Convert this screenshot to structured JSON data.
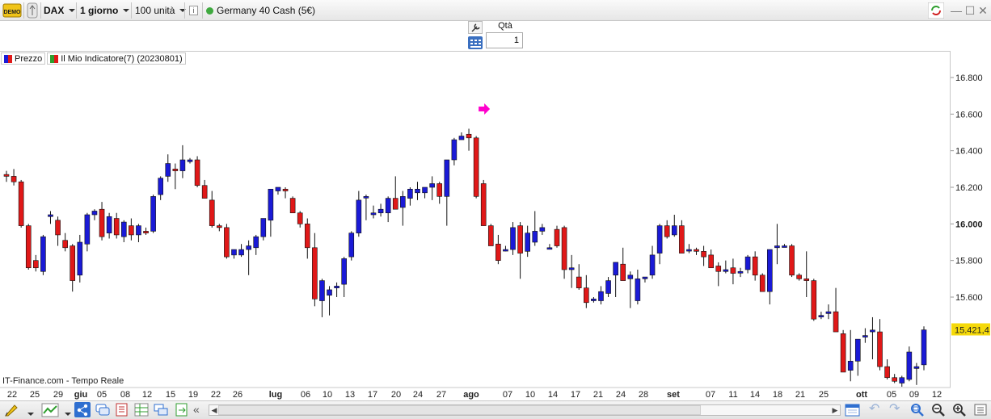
{
  "toolbar": {
    "demo_label": "DEMO",
    "instrument": "DAX",
    "timeframe": "1 giorno",
    "units": "100 unità",
    "info_label": "i",
    "market": "Germany 40 Cash (5€)",
    "market_status_color": "#3fa93f"
  },
  "order": {
    "qty_label": "Qtà",
    "qty_value": "1"
  },
  "legend": {
    "price_label": "Prezzo",
    "indicator_label": "Il Mio Indicatore(7) (20230801)"
  },
  "watermark": "IT-Finance.com - Tempo Reale",
  "colors": {
    "up": "#1a1ad6",
    "down": "#e01818",
    "arrow": "#ff00cc",
    "price_tag": "#f5d90a"
  },
  "chart_data": {
    "type": "candlestick",
    "y_axis": {
      "labels": [
        "16.800",
        "16.600",
        "16.400",
        "16.200",
        "16.000",
        "15.800",
        "15.600"
      ],
      "min": 15300,
      "max": 16900
    },
    "last_price": "15.421,4",
    "x_axis_labels": [
      "22",
      "25",
      "29",
      "giu",
      "05",
      "08",
      "12",
      "15",
      "19",
      "22",
      "26",
      "lug",
      "06",
      "10",
      "13",
      "17",
      "20",
      "24",
      "27",
      "ago",
      "07",
      "10",
      "14",
      "17",
      "21",
      "24",
      "28",
      "set",
      "07",
      "11",
      "14",
      "18",
      "21",
      "25",
      "ott",
      "05",
      "09",
      "12"
    ],
    "bold_x_labels": [
      "giu",
      "lug",
      "ago",
      "set",
      "ott"
    ],
    "signal_arrow": {
      "direction": "right",
      "date_index": 64
    },
    "candles": [
      [
        16270,
        16290,
        16230,
        16260
      ],
      [
        16260,
        16300,
        16210,
        16230
      ],
      [
        16230,
        16240,
        15980,
        15990
      ],
      [
        15990,
        16000,
        15750,
        15760
      ],
      [
        15800,
        15830,
        15740,
        15760
      ],
      [
        15740,
        15940,
        15720,
        15930
      ],
      [
        16040,
        16070,
        16000,
        16050
      ],
      [
        16020,
        16040,
        15880,
        15940
      ],
      [
        15910,
        15950,
        15850,
        15870
      ],
      [
        15880,
        15890,
        15630,
        15690
      ],
      [
        15720,
        15940,
        15680,
        15900
      ],
      [
        15890,
        16060,
        15850,
        16050
      ],
      [
        16050,
        16080,
        16020,
        16070
      ],
      [
        16080,
        16120,
        15910,
        15930
      ],
      [
        15950,
        16060,
        15920,
        16040
      ],
      [
        16030,
        16060,
        15920,
        15940
      ],
      [
        15930,
        16020,
        15900,
        16010
      ],
      [
        15990,
        16030,
        15910,
        15940
      ],
      [
        15940,
        16000,
        15900,
        15990
      ],
      [
        15960,
        15980,
        15940,
        15950
      ],
      [
        15960,
        16160,
        15950,
        16150
      ],
      [
        16160,
        16260,
        16130,
        16250
      ],
      [
        16260,
        16380,
        16230,
        16330
      ],
      [
        16300,
        16330,
        16190,
        16290
      ],
      [
        16290,
        16430,
        16250,
        16350
      ],
      [
        16340,
        16360,
        16330,
        16350
      ],
      [
        16350,
        16370,
        16200,
        16210
      ],
      [
        16210,
        16240,
        16140,
        16140
      ],
      [
        16130,
        16180,
        15980,
        15990
      ],
      [
        15990,
        16000,
        15960,
        15980
      ],
      [
        15980,
        16000,
        15810,
        15820
      ],
      [
        15830,
        15860,
        15810,
        15860
      ],
      [
        15830,
        15890,
        15820,
        15860
      ],
      [
        15860,
        15910,
        15720,
        15880
      ],
      [
        15870,
        15940,
        15830,
        15930
      ],
      [
        15930,
        16030,
        15910,
        16030
      ],
      [
        16020,
        16150,
        15930,
        16190
      ],
      [
        16180,
        16200,
        16160,
        16200
      ],
      [
        16190,
        16200,
        16140,
        16180
      ],
      [
        16140,
        16150,
        16060,
        16060
      ],
      [
        16060,
        16070,
        15980,
        16000
      ],
      [
        16000,
        16030,
        15810,
        15870
      ],
      [
        15870,
        15950,
        15550,
        15590
      ],
      [
        15580,
        15700,
        15490,
        15690
      ],
      [
        15610,
        15660,
        15500,
        15640
      ],
      [
        15650,
        15680,
        15600,
        15660
      ],
      [
        15670,
        15820,
        15600,
        15810
      ],
      [
        15820,
        15960,
        15800,
        15950
      ],
      [
        15950,
        16180,
        15930,
        16130
      ],
      [
        16150,
        16160,
        16020,
        16150
      ],
      [
        16050,
        16100,
        16030,
        16060
      ],
      [
        16060,
        16110,
        16040,
        16080
      ],
      [
        16060,
        16150,
        16010,
        16140
      ],
      [
        16140,
        16260,
        16080,
        16080
      ],
      [
        16090,
        16180,
        15990,
        16150
      ],
      [
        16140,
        16200,
        16100,
        16190
      ],
      [
        16170,
        16230,
        16130,
        16190
      ],
      [
        16170,
        16200,
        16140,
        16200
      ],
      [
        16200,
        16260,
        16130,
        16220
      ],
      [
        16220,
        16230,
        16110,
        16150
      ],
      [
        16150,
        16220,
        15990,
        16350
      ],
      [
        16350,
        16470,
        16320,
        16460
      ],
      [
        16460,
        16500,
        16480,
        16480
      ],
      [
        16490,
        16520,
        16400,
        16470
      ],
      [
        16470,
        16480,
        16140,
        16150
      ],
      [
        16220,
        16240,
        15990,
        15990
      ],
      [
        15990,
        16000,
        15880,
        15880
      ],
      [
        15890,
        15940,
        15780,
        15800
      ],
      [
        15860,
        15880,
        15850,
        15860
      ],
      [
        15860,
        16010,
        15830,
        15980
      ],
      [
        15990,
        16010,
        15700,
        15840
      ],
      [
        15850,
        15990,
        15820,
        15950
      ],
      [
        15900,
        16070,
        15880,
        15960
      ],
      [
        15960,
        16000,
        15940,
        15980
      ],
      [
        15870,
        15890,
        15860,
        15870
      ],
      [
        15970,
        15990,
        15870,
        15880
      ],
      [
        15980,
        15990,
        15700,
        15750
      ],
      [
        15750,
        15830,
        15650,
        15760
      ],
      [
        15710,
        15780,
        15640,
        15650
      ],
      [
        15650,
        15720,
        15540,
        15570
      ],
      [
        15580,
        15600,
        15570,
        15590
      ],
      [
        15580,
        15660,
        15560,
        15630
      ],
      [
        15620,
        15710,
        15600,
        15690
      ],
      [
        15720,
        15790,
        15600,
        15790
      ],
      [
        15780,
        15870,
        15700,
        15690
      ],
      [
        15700,
        15740,
        15540,
        15720
      ],
      [
        15580,
        15750,
        15560,
        15700
      ],
      [
        15700,
        15710,
        15680,
        15710
      ],
      [
        15720,
        15880,
        15700,
        15830
      ],
      [
        15840,
        16000,
        15780,
        15990
      ],
      [
        15990,
        16020,
        15920,
        15930
      ],
      [
        15940,
        16050,
        15930,
        15990
      ],
      [
        15990,
        16020,
        15860,
        15840
      ],
      [
        15860,
        15890,
        15840,
        15860
      ],
      [
        15860,
        15870,
        15830,
        15850
      ],
      [
        15850,
        15880,
        15770,
        15820
      ],
      [
        15830,
        15860,
        15770,
        15760
      ],
      [
        15770,
        15790,
        15660,
        15740
      ],
      [
        15740,
        15800,
        15730,
        15750
      ],
      [
        15760,
        15810,
        15670,
        15730
      ],
      [
        15740,
        15760,
        15710,
        15740
      ],
      [
        15750,
        15830,
        15730,
        15820
      ],
      [
        15820,
        15850,
        15690,
        15720
      ],
      [
        15720,
        15730,
        15640,
        15630
      ],
      [
        15630,
        15860,
        15560,
        15860
      ],
      [
        15870,
        16000,
        15780,
        15880
      ],
      [
        15880,
        15890,
        15880,
        15880
      ],
      [
        15880,
        15890,
        15710,
        15720
      ],
      [
        15720,
        15730,
        15690,
        15700
      ],
      [
        15700,
        15850,
        15600,
        15690
      ],
      [
        15690,
        15700,
        15470,
        15480
      ],
      [
        15500,
        15520,
        15480,
        15500
      ],
      [
        15510,
        15560,
        15480,
        15520
      ],
      [
        15520,
        15650,
        15420,
        15410
      ],
      [
        15400,
        15420,
        15200,
        15190
      ],
      [
        15200,
        15420,
        15140,
        15250
      ],
      [
        15250,
        15360,
        15170,
        15370
      ],
      [
        15390,
        15430,
        15350,
        15390
      ],
      [
        15410,
        15490,
        15260,
        15420
      ],
      [
        15410,
        15480,
        15200,
        15220
      ],
      [
        15220,
        15260,
        15150,
        15160
      ],
      [
        15160,
        15180,
        15130,
        15140
      ],
      [
        15130,
        15170,
        15100,
        15160
      ],
      [
        15150,
        15330,
        15140,
        15300
      ],
      [
        15210,
        15240,
        15120,
        15220
      ],
      [
        15230,
        15440,
        15200,
        15421
      ]
    ]
  }
}
